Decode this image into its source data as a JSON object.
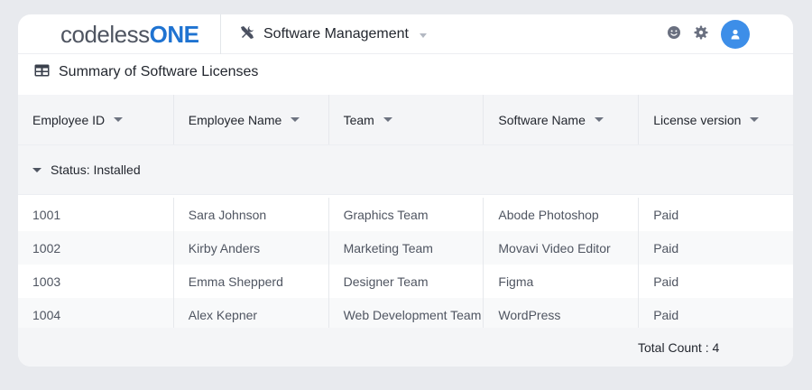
{
  "header": {
    "logo_part1": "codeless",
    "logo_part2": "ONE",
    "app_title": "Software Management"
  },
  "section": {
    "title": "Summary of Software Licenses"
  },
  "table": {
    "columns": [
      "Employee ID",
      "Employee Name",
      "Team",
      "Software Name",
      "License version"
    ],
    "group_label": "Status: Installed",
    "rows": [
      [
        "1001",
        "Sara Johnson",
        "Graphics Team",
        "Abode Photoshop",
        "Paid"
      ],
      [
        "1002",
        "Kirby Anders",
        "Marketing Team",
        "Movavi Video Editor",
        "Paid"
      ],
      [
        "1003",
        "Emma Shepperd",
        "Designer Team",
        "Figma",
        "Paid"
      ],
      [
        "1004",
        "Alex Kepner",
        "Web Development Team",
        "WordPress",
        "Paid"
      ]
    ]
  },
  "footer": {
    "total_count": "Total Count : 4"
  },
  "icons": {
    "app": "tools-icon",
    "section": "table-icon",
    "feedback": "smiley-icon",
    "settings": "gear-icon",
    "user": "user-icon"
  },
  "colors": {
    "brand": "#1f73d1",
    "avatar": "#3d8ee8"
  }
}
